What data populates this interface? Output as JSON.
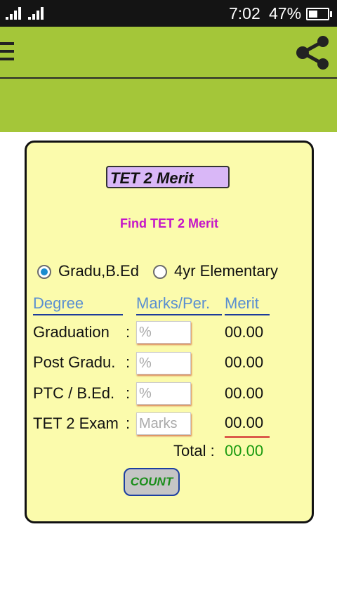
{
  "status_bar": {
    "time": "7:02",
    "battery_percent": "47%"
  },
  "card": {
    "title": "TET 2 Merit",
    "subtitle": "Find TET 2 Merit",
    "options": [
      {
        "label": "Gradu,B.Ed",
        "selected": true
      },
      {
        "label": "4yr Elementary",
        "selected": false
      }
    ],
    "headers": {
      "degree": "Degree",
      "marks": "Marks/Per.",
      "merit": "Merit"
    },
    "rows": [
      {
        "label": "Graduation",
        "colon": ":",
        "placeholder": "%",
        "merit": "00.00"
      },
      {
        "label": "Post Gradu.",
        "colon": ":",
        "placeholder": "%",
        "merit": "00.00"
      },
      {
        "label": "PTC / B.Ed.",
        "colon": ":",
        "placeholder": "%",
        "merit": "00.00"
      },
      {
        "label": "TET 2 Exam",
        "colon": ":",
        "placeholder": "Marks",
        "merit": "00.00"
      }
    ],
    "total_label": "Total :",
    "total_value": "00.00",
    "count_button": "COUNT"
  }
}
